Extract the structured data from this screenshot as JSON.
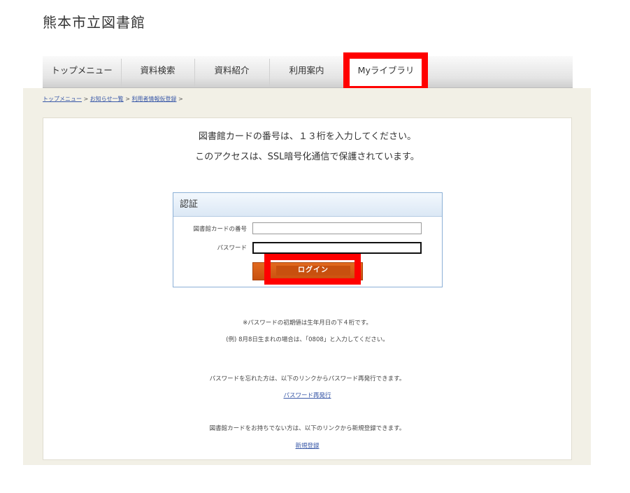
{
  "site": {
    "title": "熊本市立図書館"
  },
  "nav": {
    "items": [
      {
        "label": "トップメニュー"
      },
      {
        "label": "資料検索"
      },
      {
        "label": "資料紹介"
      },
      {
        "label": "利用案内"
      },
      {
        "label": "Myライブラリ"
      }
    ],
    "active": "Myライブラリ"
  },
  "breadcrumb": {
    "items": [
      "トップメニュー",
      "お知らせ一覧",
      "利用者情報仮登録"
    ],
    "separator": ">"
  },
  "intro": {
    "line1": "図書館カードの番号は、１３桁を入力してください。",
    "line2": "このアクセスは、SSL暗号化通信で保護されています。"
  },
  "login": {
    "heading": "認証",
    "card_label": "図書館カードの番号",
    "card_value": "",
    "password_label": "パスワード",
    "password_value": "",
    "button": "ログイン"
  },
  "notes": {
    "password_initial": "※パスワードの初期値は生年月日の下４桁です。",
    "password_example": "(例) 8月8日生まれの場合は、「0808」と入力してください。",
    "forgot_text": "パスワードを忘れた方は、以下のリンクからパスワード再発行できます。",
    "forgot_link": "パスワード再発行",
    "register_text": "図書館カードをお持ちでない方は、以下のリンクから新規登録できます。",
    "register_link": "新規登録"
  },
  "colors": {
    "highlight": "#ff0000",
    "button": "#c8500f",
    "band": "#f2f0e6",
    "link": "#3a59a8"
  }
}
